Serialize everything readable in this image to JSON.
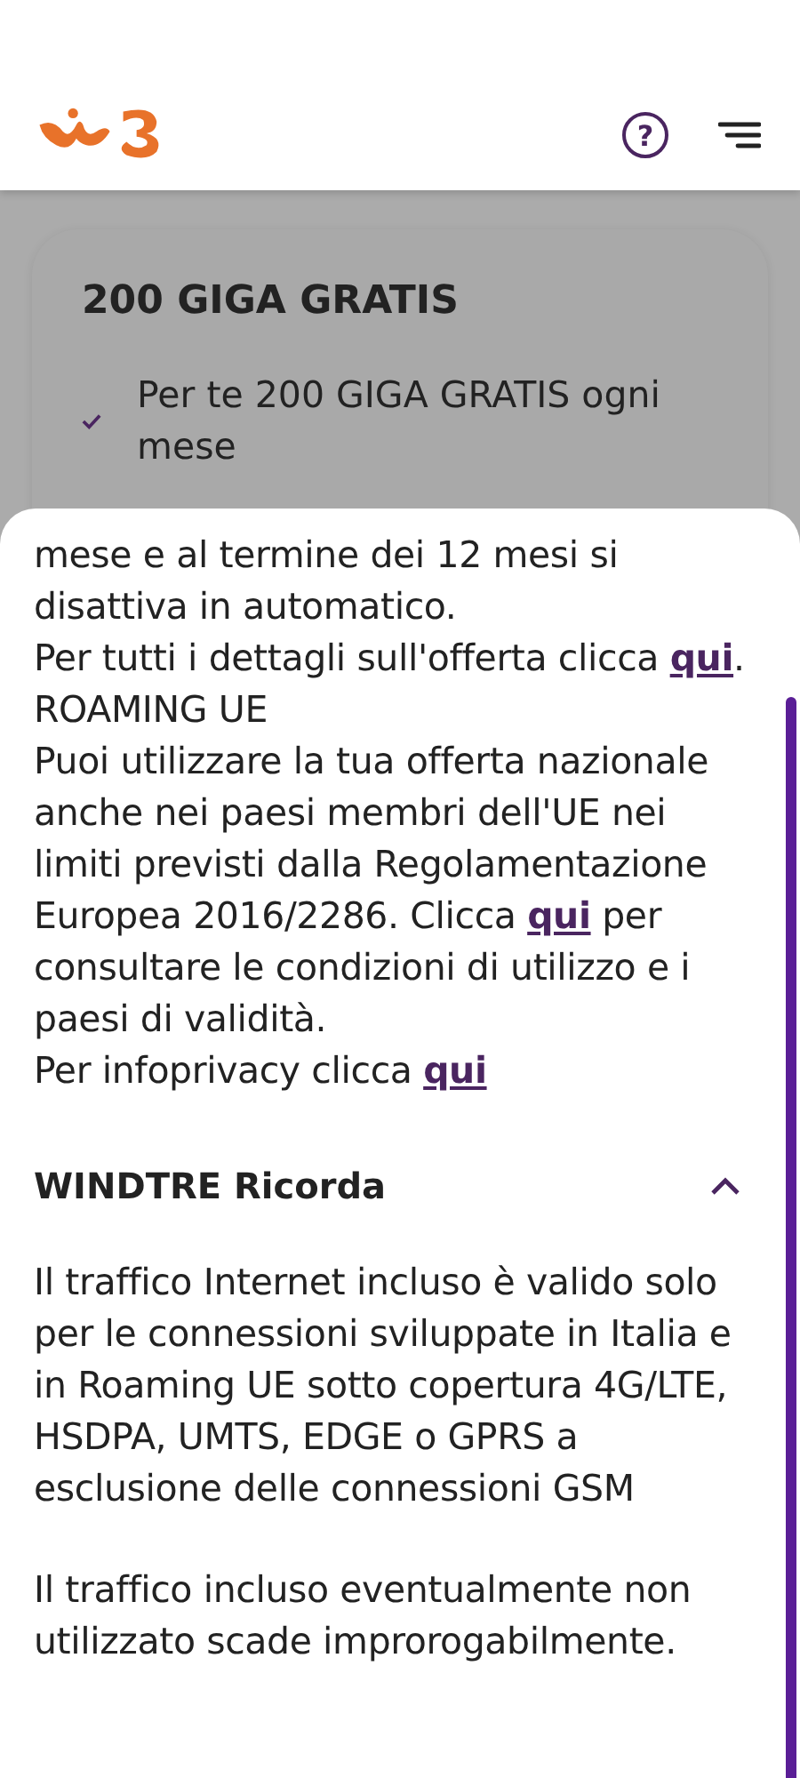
{
  "header": {
    "help_label": "?"
  },
  "card": {
    "title": "200 GIGA GRATIS",
    "items": [
      {
        "text": "Per te 200 GIGA GRATIS ogni mese",
        "checked": true
      }
    ]
  },
  "sheet": {
    "paragraphs": [
      [
        {
          "text": "mese e al termine dei 12 mesi si disattiva in automatico.",
          "kind": "text"
        }
      ],
      [
        {
          "text": "Per tutti i dettagli sull'offerta clicca ",
          "kind": "text"
        },
        {
          "text": "qui",
          "kind": "link"
        },
        {
          "text": ".",
          "kind": "text"
        }
      ],
      [
        {
          "text": "ROAMING UE",
          "kind": "text"
        }
      ],
      [
        {
          "text": "Puoi utilizzare la tua offerta nazionale anche nei paesi membri dell'UE nei limiti previsti dalla Regolamentazione Europea 2016/2286. Clicca ",
          "kind": "text"
        },
        {
          "text": "qui",
          "kind": "link"
        },
        {
          "text": " per consultare le condizioni di utilizzo e i paesi di validità.",
          "kind": "text"
        }
      ],
      [
        {
          "text": "Per infoprivacy clicca ",
          "kind": "text"
        },
        {
          "text": "qui",
          "kind": "link"
        }
      ]
    ],
    "accordion": {
      "title": "WINDTRE Ricorda",
      "expanded": true,
      "paragraphs": [
        "Il traffico Internet incluso è valido solo per le connessioni sviluppate in Italia e in Roaming UE sotto copertura 4G/LTE, HSDPA, UMTS, EDGE o GPRS a esclusione delle connessioni GSM",
        "Il traffico incluso eventualmente non utilizzato scade improrogabilmente."
      ]
    }
  }
}
